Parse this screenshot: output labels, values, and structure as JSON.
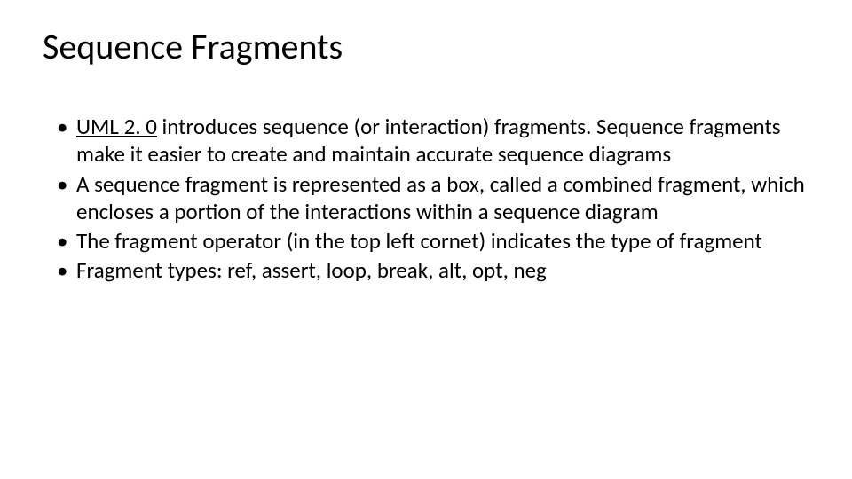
{
  "title": "Sequence Fragments",
  "link_text": "UML 2. 0",
  "bullets": [
    {
      "after_link": " introduces sequence (or interaction) fragments. Sequence fragments make it easier to create and maintain accurate sequence diagrams"
    },
    "A sequence fragment is represented as a box, called a combined fragment, which encloses a portion of the interactions within a sequence diagram",
    "The fragment operator (in the top left cornet) indicates the type of fragment",
    "Fragment types: ref, assert, loop, break, alt, opt, neg"
  ]
}
